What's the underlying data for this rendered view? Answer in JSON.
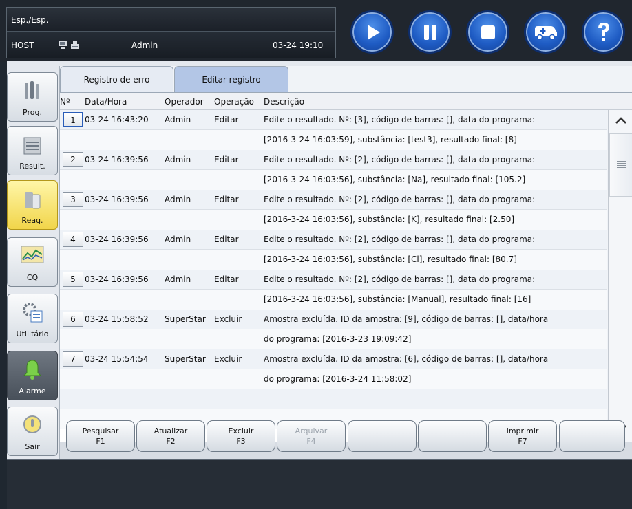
{
  "header": {
    "mode": "Esp./Esp.",
    "host": "HOST",
    "user": "Admin",
    "time": "03-24 19:10",
    "buttons": [
      {
        "name": "play-icon"
      },
      {
        "name": "pause-icon"
      },
      {
        "name": "stop-icon"
      },
      {
        "name": "ambulance-icon"
      },
      {
        "name": "help-icon"
      }
    ]
  },
  "sidebar": {
    "items": [
      {
        "label": "Prog.",
        "icon": "vials-icon"
      },
      {
        "label": "Result.",
        "icon": "printer-report-icon"
      },
      {
        "label": "Reag.",
        "icon": "reagent-bottles-icon"
      },
      {
        "label": "CQ",
        "icon": "chart-icon"
      },
      {
        "label": "Utilitário",
        "icon": "gear-icon"
      },
      {
        "label": "Alarme",
        "icon": "bell-icon"
      },
      {
        "label": "Sair",
        "icon": "power-icon"
      }
    ]
  },
  "tabs": [
    {
      "label": "Registro de erro"
    },
    {
      "label": "Editar registro"
    }
  ],
  "table": {
    "columns": [
      "Nº",
      "Data/Hora",
      "Operador",
      "Operação",
      "Descrição"
    ],
    "rows": [
      {
        "n": "1",
        "datetime": "03-24 16:43:20",
        "operator": "Admin",
        "operation": "Editar",
        "desc1": "Edite o resultado. Nº: [3], código de barras: [], data do programa:",
        "desc2": "[2016-3-24 16:03:59], substância: [test3], resultado final: [8]"
      },
      {
        "n": "2",
        "datetime": "03-24 16:39:56",
        "operator": "Admin",
        "operation": "Editar",
        "desc1": "Edite o resultado. Nº: [2], código de barras: [], data do programa:",
        "desc2": "[2016-3-24 16:03:56], substância: [Na], resultado final: [105.2]"
      },
      {
        "n": "3",
        "datetime": "03-24 16:39:56",
        "operator": "Admin",
        "operation": "Editar",
        "desc1": "Edite o resultado. Nº: [2], código de barras: [], data do programa:",
        "desc2": "[2016-3-24 16:03:56], substância: [K], resultado final: [2.50]"
      },
      {
        "n": "4",
        "datetime": "03-24 16:39:56",
        "operator": "Admin",
        "operation": "Editar",
        "desc1": "Edite o resultado. Nº: [2], código de barras: [], data do programa:",
        "desc2": "[2016-3-24 16:03:56], substância: [Cl], resultado final: [80.7]"
      },
      {
        "n": "5",
        "datetime": "03-24 16:39:56",
        "operator": "Admin",
        "operation": "Editar",
        "desc1": "Edite o resultado. Nº: [2], código de barras: [], data do programa:",
        "desc2": "[2016-3-24 16:03:56], substância: [Manual], resultado final: [16]"
      },
      {
        "n": "6",
        "datetime": "03-24 15:58:52",
        "operator": "SuperStar",
        "operation": "Excluir",
        "desc1": "Amostra excluída. ID da amostra: [9], código de barras: [], data/hora",
        "desc2": "do programa: [2016-3-23 19:09:42]"
      },
      {
        "n": "7",
        "datetime": "03-24 15:54:54",
        "operator": "SuperStar",
        "operation": "Excluir",
        "desc1": "Amostra excluída. ID da amostra: [6], código de barras: [], data/hora",
        "desc2": "do programa: [2016-3-24 11:58:02]"
      }
    ]
  },
  "buttons": [
    {
      "label": "Pesquisar",
      "key": "F1",
      "enabled": true
    },
    {
      "label": "Atualizar",
      "key": "F2",
      "enabled": true
    },
    {
      "label": "Excluir",
      "key": "F3",
      "enabled": true
    },
    {
      "label": "Arquivar",
      "key": "F4",
      "enabled": false
    },
    {
      "label": "",
      "key": "",
      "enabled": true
    },
    {
      "label": "",
      "key": "",
      "enabled": true
    },
    {
      "label": "Imprimir",
      "key": "F7",
      "enabled": true
    },
    {
      "label": "",
      "key": "",
      "enabled": true
    }
  ]
}
